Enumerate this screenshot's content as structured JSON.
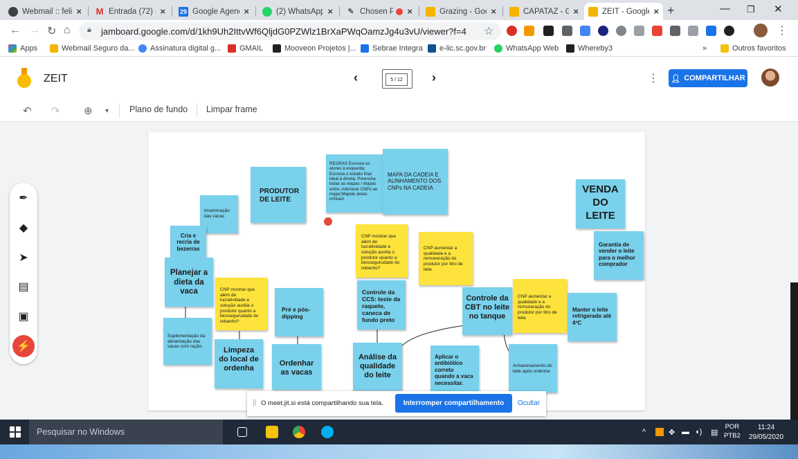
{
  "browser": {
    "tabs": [
      {
        "label": "Webmail :: feli",
        "color": "#3c4043"
      },
      {
        "label": "Entrada (72) - ",
        "color": "#d93025"
      },
      {
        "label": "Google Agend",
        "color": "#1a73e8"
      },
      {
        "label": "(2) WhatsApp",
        "color": "#25d366"
      },
      {
        "label": "Chosen Pe",
        "color": "#5f6368"
      },
      {
        "label": "Grazing - Goo",
        "color": "#f4b400"
      },
      {
        "label": "CAPATAZ - Go",
        "color": "#f4b400"
      },
      {
        "label": "ZEIT - Google",
        "color": "#f4b400"
      }
    ],
    "url": "jamboard.google.com/d/1kh9Uh2IttvWf6QljdG0PZWlz1BrXaPWqOamzJg4u3vU/viewer?f=4",
    "bookmarks": [
      {
        "label": "Apps",
        "color": "#ea4335"
      },
      {
        "label": "Webmail Seguro da...",
        "color": "#f4b400"
      },
      {
        "label": "Assinatura digital g...",
        "color": "#4285f4"
      },
      {
        "label": "GMAIL",
        "color": "#d93025"
      },
      {
        "label": "Mooveon Projetos |...",
        "color": "#202124"
      },
      {
        "label": "Sebrae Integra",
        "color": "#1a73e8"
      },
      {
        "label": "e-lic.sc.gov.br",
        "color": "#0b5394"
      },
      {
        "label": "WhatsApp Web",
        "color": "#25d366"
      },
      {
        "label": "Whereby3",
        "color": "#202124"
      }
    ],
    "other_bookmarks": "Outros favoritos",
    "more_bookmarks": "»"
  },
  "app": {
    "title": "ZEIT",
    "frame_indicator": "5 / 12",
    "share_label": "COMPARTILHAR",
    "toolbar": {
      "background": "Plano de fundo",
      "clear": "Limpar frame"
    }
  },
  "notes": [
    {
      "text": "REGRAS Escreva os atores à esquerda; Escreva o estado final ideal à direita; Preencha todas as etapas / etapas entre; Adicionar CNPs ao mapa;Mapele áreas críticas!",
      "color": "blue"
    },
    {
      "text": "MAPA DA CADEIA E ALINHAMENTO DOS CNPs NA CADEIA",
      "color": "blue"
    },
    {
      "text": "PRODUTOR DE LEITE",
      "color": "blue"
    },
    {
      "text": "Inseminação das vacas",
      "color": "blue"
    },
    {
      "text": "Cria e recria de bezerras",
      "color": "blue"
    },
    {
      "text": "Planejar a dieta da vaca",
      "color": "blue"
    },
    {
      "text": "Suplementação da alimentação das vacas com ração.",
      "color": "blue"
    },
    {
      "text": "CNP mostrar que além de lucratividade a solução auxilia o produtor quanto a biossegurudade do rebanho?",
      "color": "yellow"
    },
    {
      "text": "Limpeza do local de ordenha",
      "color": "blue"
    },
    {
      "text": "Pré e pós-dipping",
      "color": "blue"
    },
    {
      "text": "Ordenhar as vacas",
      "color": "blue"
    },
    {
      "text": "CNP mostrar que além de lucratividade a solução auxilia o produtor quanto a biossegurudade do rebanho?",
      "color": "yellow"
    },
    {
      "text": "Controle da CCS: teste da raquete, caneca de fundo preto",
      "color": "blue"
    },
    {
      "text": "Análise da qualidade do leite",
      "color": "blue"
    },
    {
      "text": "CNP aumentar a qualidade e a remuneração do produtor por litro de leite",
      "color": "yellow"
    },
    {
      "text": "Controle da CBT no leite no tanque",
      "color": "blue"
    },
    {
      "text": "Aplicar o antibiótico correto quando a vaca necessitar.",
      "color": "blue"
    },
    {
      "text": "CNP aumentar a qualidade e a remuneração do produtor por litro de leite",
      "color": "yellow"
    },
    {
      "text": "Armazenamento do leite após ordenha",
      "color": "blue"
    },
    {
      "text": "Manter o leite refrigerado até 4ºC",
      "color": "blue"
    },
    {
      "text": "Garantia de vender o leite para o melhor comprador",
      "color": "blue"
    },
    {
      "text": "VENDA DO LEITE",
      "color": "blue"
    }
  ],
  "notification": {
    "message": "O meet.jit.si está compartilhando sua tela.",
    "stop": "Interromper compartilhamento",
    "hide": "Ocultar"
  },
  "taskbar": {
    "search_placeholder": "Pesquisar no Windows",
    "lang_line1": "POR",
    "lang_line2": "PTB2",
    "time": "11:24",
    "date": "29/05/2020"
  }
}
